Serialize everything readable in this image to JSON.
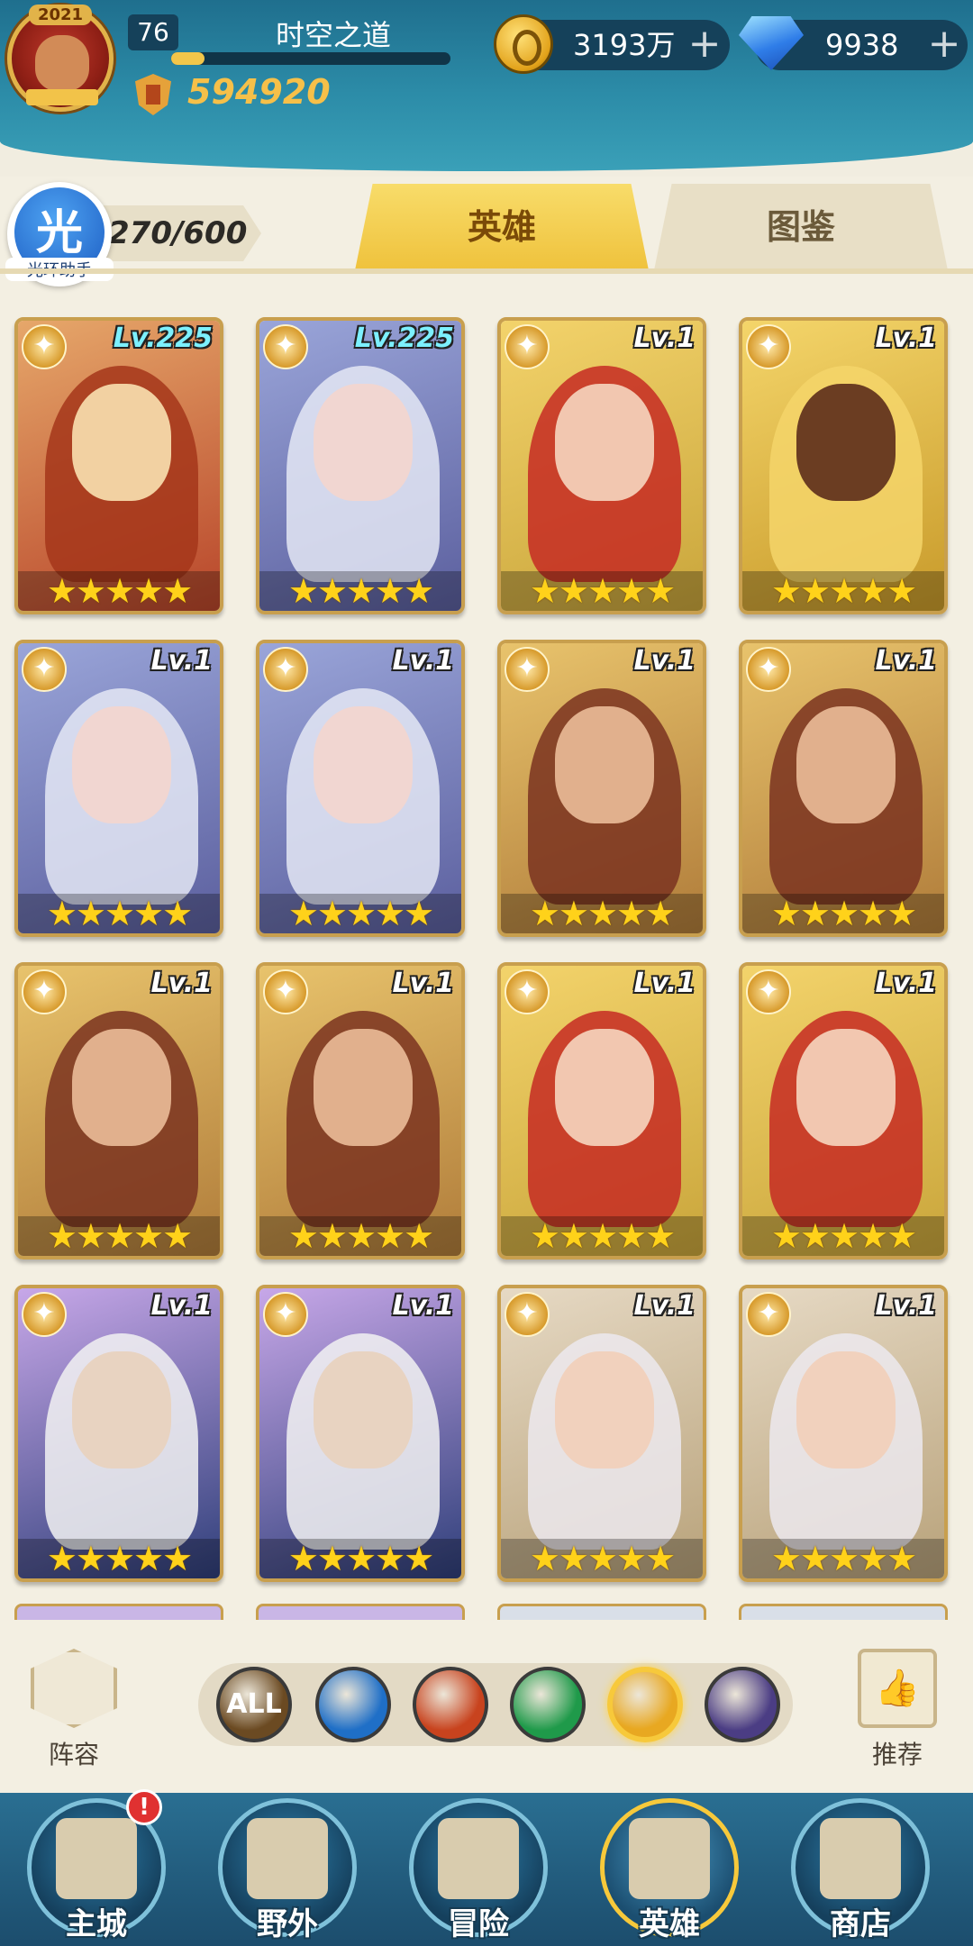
{
  "player": {
    "avatar_year": "2021",
    "level": "76",
    "name": "时空之道",
    "power": "594920"
  },
  "resources": {
    "gold": "3193万",
    "gems": "9938",
    "plus": "+"
  },
  "helper": {
    "glyph": "光",
    "label": "光环助手"
  },
  "hero_count": "270/600",
  "tabs": [
    {
      "label": "英雄",
      "active": true
    },
    {
      "label": "图鉴",
      "active": false
    }
  ],
  "heroes": [
    {
      "level": "Lv.225",
      "stars": "★★★★★",
      "portrait": "fire-warrior"
    },
    {
      "level": "Lv.225",
      "stars": "★★★★★",
      "portrait": "silver-elf"
    },
    {
      "level": "Lv.1",
      "stars": "★★★★★",
      "portrait": "helmed-priestess"
    },
    {
      "level": "Lv.1",
      "stars": "★★★★★",
      "portrait": "golden-sorceress"
    },
    {
      "level": "Lv.1",
      "stars": "★★★★★",
      "portrait": "silver-elf"
    },
    {
      "level": "Lv.1",
      "stars": "★★★★★",
      "portrait": "silver-elf"
    },
    {
      "level": "Lv.1",
      "stars": "★★★★★",
      "portrait": "golden-king"
    },
    {
      "level": "Lv.1",
      "stars": "★★★★★",
      "portrait": "golden-king"
    },
    {
      "level": "Lv.1",
      "stars": "★★★★★",
      "portrait": "golden-king"
    },
    {
      "level": "Lv.1",
      "stars": "★★★★★",
      "portrait": "golden-king"
    },
    {
      "level": "Lv.1",
      "stars": "★★★★★",
      "portrait": "helmed-priestess"
    },
    {
      "level": "Lv.1",
      "stars": "★★★★★",
      "portrait": "helmed-priestess"
    },
    {
      "level": "Lv.1",
      "stars": "★★★★★",
      "portrait": "bearded-sage"
    },
    {
      "level": "Lv.1",
      "stars": "★★★★★",
      "portrait": "bearded-sage"
    },
    {
      "level": "Lv.1",
      "stars": "★★★★★",
      "portrait": "white-haired-queen"
    },
    {
      "level": "Lv.1",
      "stars": "★★★★★",
      "portrait": "white-haired-queen"
    }
  ],
  "filters": {
    "formation_label": "阵容",
    "recommend_label": "推荐",
    "buttons": [
      {
        "label": "ALL",
        "icon": "all-factions-icon",
        "color": "#6b4a22"
      },
      {
        "label": "",
        "icon": "water-faction-icon",
        "color": "#1f6fc7"
      },
      {
        "label": "",
        "icon": "fire-faction-icon",
        "color": "#c8431e"
      },
      {
        "label": "",
        "icon": "nature-faction-icon",
        "color": "#1f9a4a"
      },
      {
        "label": "",
        "icon": "light-faction-icon",
        "color": "#e8a821",
        "selected": true
      },
      {
        "label": "",
        "icon": "dark-faction-icon",
        "color": "#4b3d84"
      }
    ]
  },
  "nav": [
    {
      "label": "主城",
      "icon": "castle-icon",
      "alert": "!"
    },
    {
      "label": "野外",
      "icon": "wilderness-icon"
    },
    {
      "label": "冒险",
      "icon": "sword-icon"
    },
    {
      "label": "英雄",
      "icon": "helmet-icon",
      "active": true
    },
    {
      "label": "商店",
      "icon": "shop-icon"
    }
  ]
}
